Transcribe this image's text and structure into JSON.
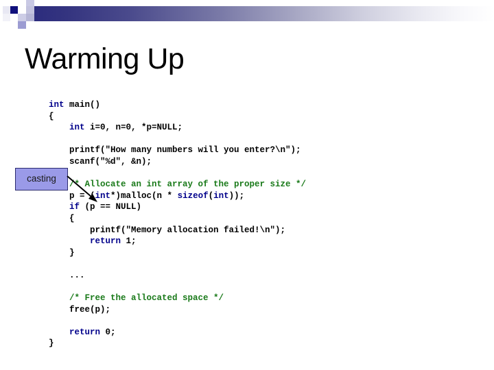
{
  "slide": {
    "title": "Warming Up"
  },
  "header": {
    "accent_dark": "#2b2b7e",
    "accent_light": "#ffffff",
    "squares_icon": "mosaic-squares-icon"
  },
  "callout": {
    "label": "casting",
    "fill_color": "#9a9ae8",
    "border_color": "#2a2a6e",
    "arrow_icon": "arrow-pointer-icon"
  },
  "code": {
    "language": "c",
    "keyword_color": "#00008b",
    "comment_color": "#1a7a1a",
    "text_color": "#000000",
    "lines": [
      {
        "indent": 0,
        "tokens": [
          {
            "t": "int",
            "c": "kw"
          },
          {
            "t": " main()",
            "c": "plain"
          }
        ]
      },
      {
        "indent": 0,
        "tokens": [
          {
            "t": "{",
            "c": "plain"
          }
        ]
      },
      {
        "indent": 1,
        "tokens": [
          {
            "t": "int",
            "c": "kw"
          },
          {
            "t": " i=0, n=0, *p=NULL;",
            "c": "plain"
          }
        ]
      },
      {
        "indent": 0,
        "tokens": [
          {
            "t": "",
            "c": "plain"
          }
        ]
      },
      {
        "indent": 1,
        "tokens": [
          {
            "t": "printf(\"How many numbers will you enter?\\n\");",
            "c": "plain"
          }
        ]
      },
      {
        "indent": 1,
        "tokens": [
          {
            "t": "scanf(\"%d\", &n);",
            "c": "plain"
          }
        ]
      },
      {
        "indent": 0,
        "tokens": [
          {
            "t": "",
            "c": "plain"
          }
        ]
      },
      {
        "indent": 1,
        "tokens": [
          {
            "t": "/* Allocate an int array of the proper size */",
            "c": "cmt"
          }
        ]
      },
      {
        "indent": 1,
        "tokens": [
          {
            "t": "p = (",
            "c": "plain"
          },
          {
            "t": "int",
            "c": "kw"
          },
          {
            "t": "*)malloc(n * ",
            "c": "plain"
          },
          {
            "t": "sizeof",
            "c": "kw"
          },
          {
            "t": "(",
            "c": "plain"
          },
          {
            "t": "int",
            "c": "kw"
          },
          {
            "t": "));",
            "c": "plain"
          }
        ]
      },
      {
        "indent": 1,
        "tokens": [
          {
            "t": "if",
            "c": "kw"
          },
          {
            "t": " (p == NULL)",
            "c": "plain"
          }
        ]
      },
      {
        "indent": 1,
        "tokens": [
          {
            "t": "{",
            "c": "plain"
          }
        ]
      },
      {
        "indent": 2,
        "tokens": [
          {
            "t": "printf(\"Memory allocation failed!\\n\");",
            "c": "plain"
          }
        ]
      },
      {
        "indent": 2,
        "tokens": [
          {
            "t": "return",
            "c": "kw"
          },
          {
            "t": " 1;",
            "c": "plain"
          }
        ]
      },
      {
        "indent": 1,
        "tokens": [
          {
            "t": "}",
            "c": "plain"
          }
        ]
      },
      {
        "indent": 0,
        "tokens": [
          {
            "t": "",
            "c": "plain"
          }
        ]
      },
      {
        "indent": 1,
        "tokens": [
          {
            "t": "...",
            "c": "plain"
          }
        ]
      },
      {
        "indent": 0,
        "tokens": [
          {
            "t": "",
            "c": "plain"
          }
        ]
      },
      {
        "indent": 1,
        "tokens": [
          {
            "t": "/* Free the allocated space */",
            "c": "cmt"
          }
        ]
      },
      {
        "indent": 1,
        "tokens": [
          {
            "t": "free(p);",
            "c": "plain"
          }
        ]
      },
      {
        "indent": 0,
        "tokens": [
          {
            "t": "",
            "c": "plain"
          }
        ]
      },
      {
        "indent": 1,
        "tokens": [
          {
            "t": "return",
            "c": "kw"
          },
          {
            "t": " 0;",
            "c": "plain"
          }
        ]
      },
      {
        "indent": 0,
        "tokens": [
          {
            "t": "}",
            "c": "plain"
          }
        ]
      }
    ]
  }
}
